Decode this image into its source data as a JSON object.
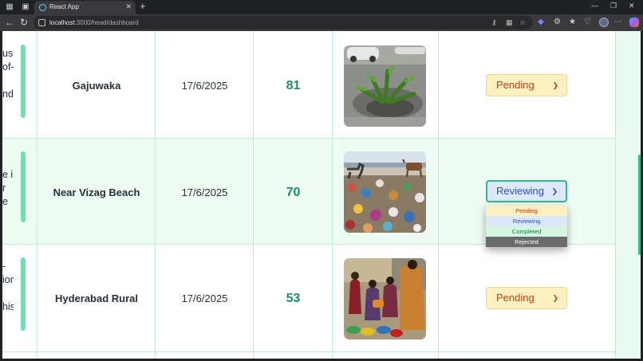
{
  "browser": {
    "tab_title": "React App",
    "url_host": "localhost",
    "url_rest": ":3000/head/dashboard"
  },
  "rows": [
    {
      "desc_lines": [
        "us",
        "of-",
        "",
        "nd"
      ],
      "location": "Gajuwaka",
      "date": "17/6/2025",
      "score": "81",
      "image": "plant-in-manhole-photo",
      "status": "Pending"
    },
    {
      "desc_lines": [
        "e in",
        "r",
        "e"
      ],
      "location": "Near Vizag Beach",
      "date": "17/6/2025",
      "score": "70",
      "image": "garbage-dump-with-goats-photo",
      "status": "Reviewing"
    },
    {
      "desc_lines": [
        "-",
        "ion",
        "",
        "his"
      ],
      "location": "Hyderabad Rural",
      "date": "17/6/2025",
      "score": "53",
      "image": "people-collecting-water-photo",
      "status": "Pending"
    }
  ],
  "status_options": [
    "Pending",
    "Reviewing",
    "Completed",
    "Rejected"
  ],
  "colors": {
    "accent_green": "#6fe0b4",
    "score_green": "#1a9160",
    "pending_bg": "#fdf1c2",
    "reviewing_bg": "#dde9fb",
    "completed_bg": "#d5f5e3",
    "rejected_bg": "#6b6b6b"
  }
}
